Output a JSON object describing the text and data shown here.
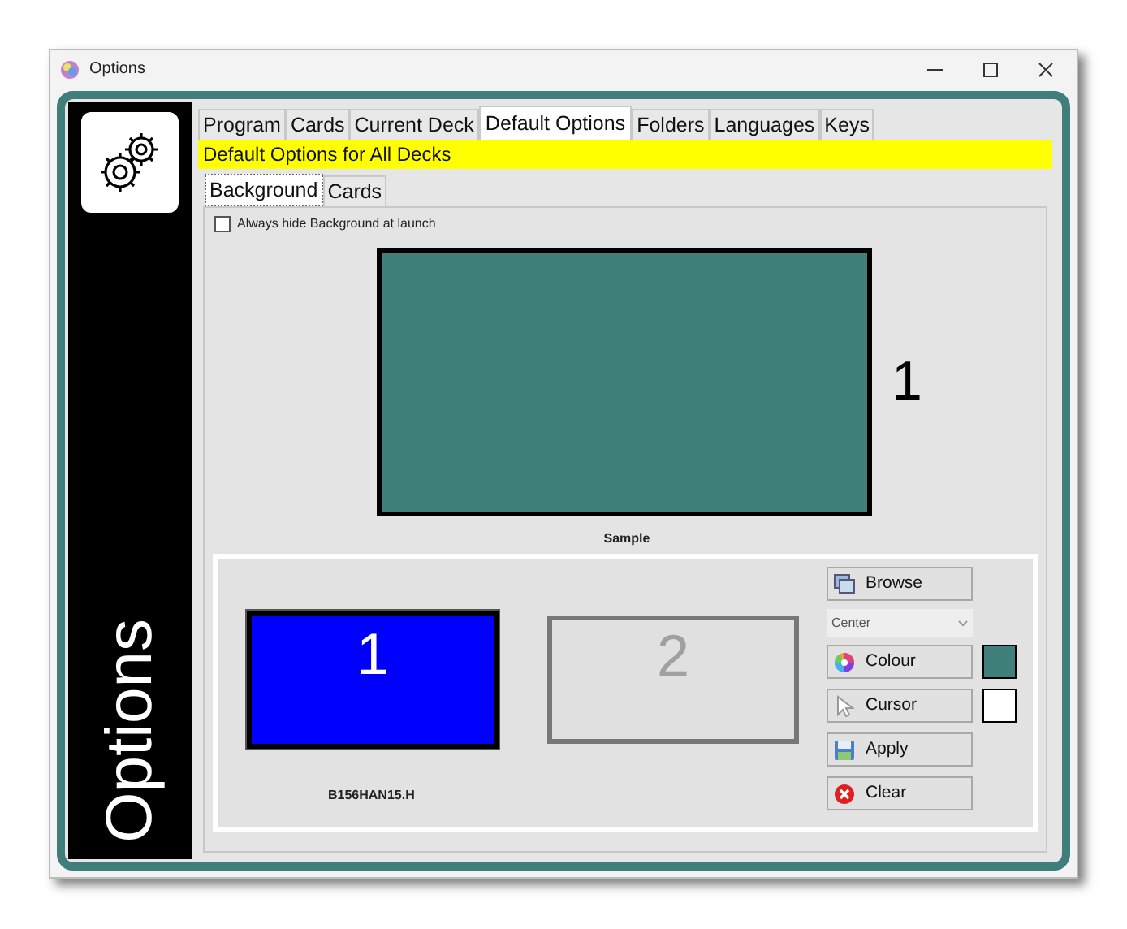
{
  "window": {
    "title": "Options"
  },
  "sidebar": {
    "title": "Options"
  },
  "tabs": [
    {
      "label": "Program",
      "selected": false
    },
    {
      "label": "Cards",
      "selected": false
    },
    {
      "label": "Current Deck",
      "selected": false
    },
    {
      "label": "Default Options",
      "selected": true
    },
    {
      "label": "Folders",
      "selected": false
    },
    {
      "label": "Languages",
      "selected": false
    },
    {
      "label": "Keys",
      "selected": false
    }
  ],
  "banner": "Default Options for All Decks",
  "subtabs": [
    {
      "label": "Background",
      "selected": true
    },
    {
      "label": "Cards",
      "selected": false
    }
  ],
  "hide_background": {
    "label": "Always hide Background at launch",
    "checked": false
  },
  "sample": {
    "color": "#407f7a",
    "number": "1",
    "label": "Sample"
  },
  "monitors": [
    {
      "label": "1",
      "selected": true
    },
    {
      "label": "2",
      "selected": false
    }
  ],
  "monitor_name": "B156HAN15.H",
  "controls": [
    {
      "kind": "browse",
      "label": "Browse"
    },
    {
      "kind": "dropdown",
      "value": "Center"
    },
    {
      "kind": "colour",
      "label": "Colour",
      "color": "#407f7a"
    },
    {
      "kind": "cursor",
      "label": "Cursor",
      "color": "#ffffff"
    },
    {
      "kind": "apply",
      "label": "Apply"
    },
    {
      "kind": "clear",
      "label": "Clear"
    }
  ]
}
